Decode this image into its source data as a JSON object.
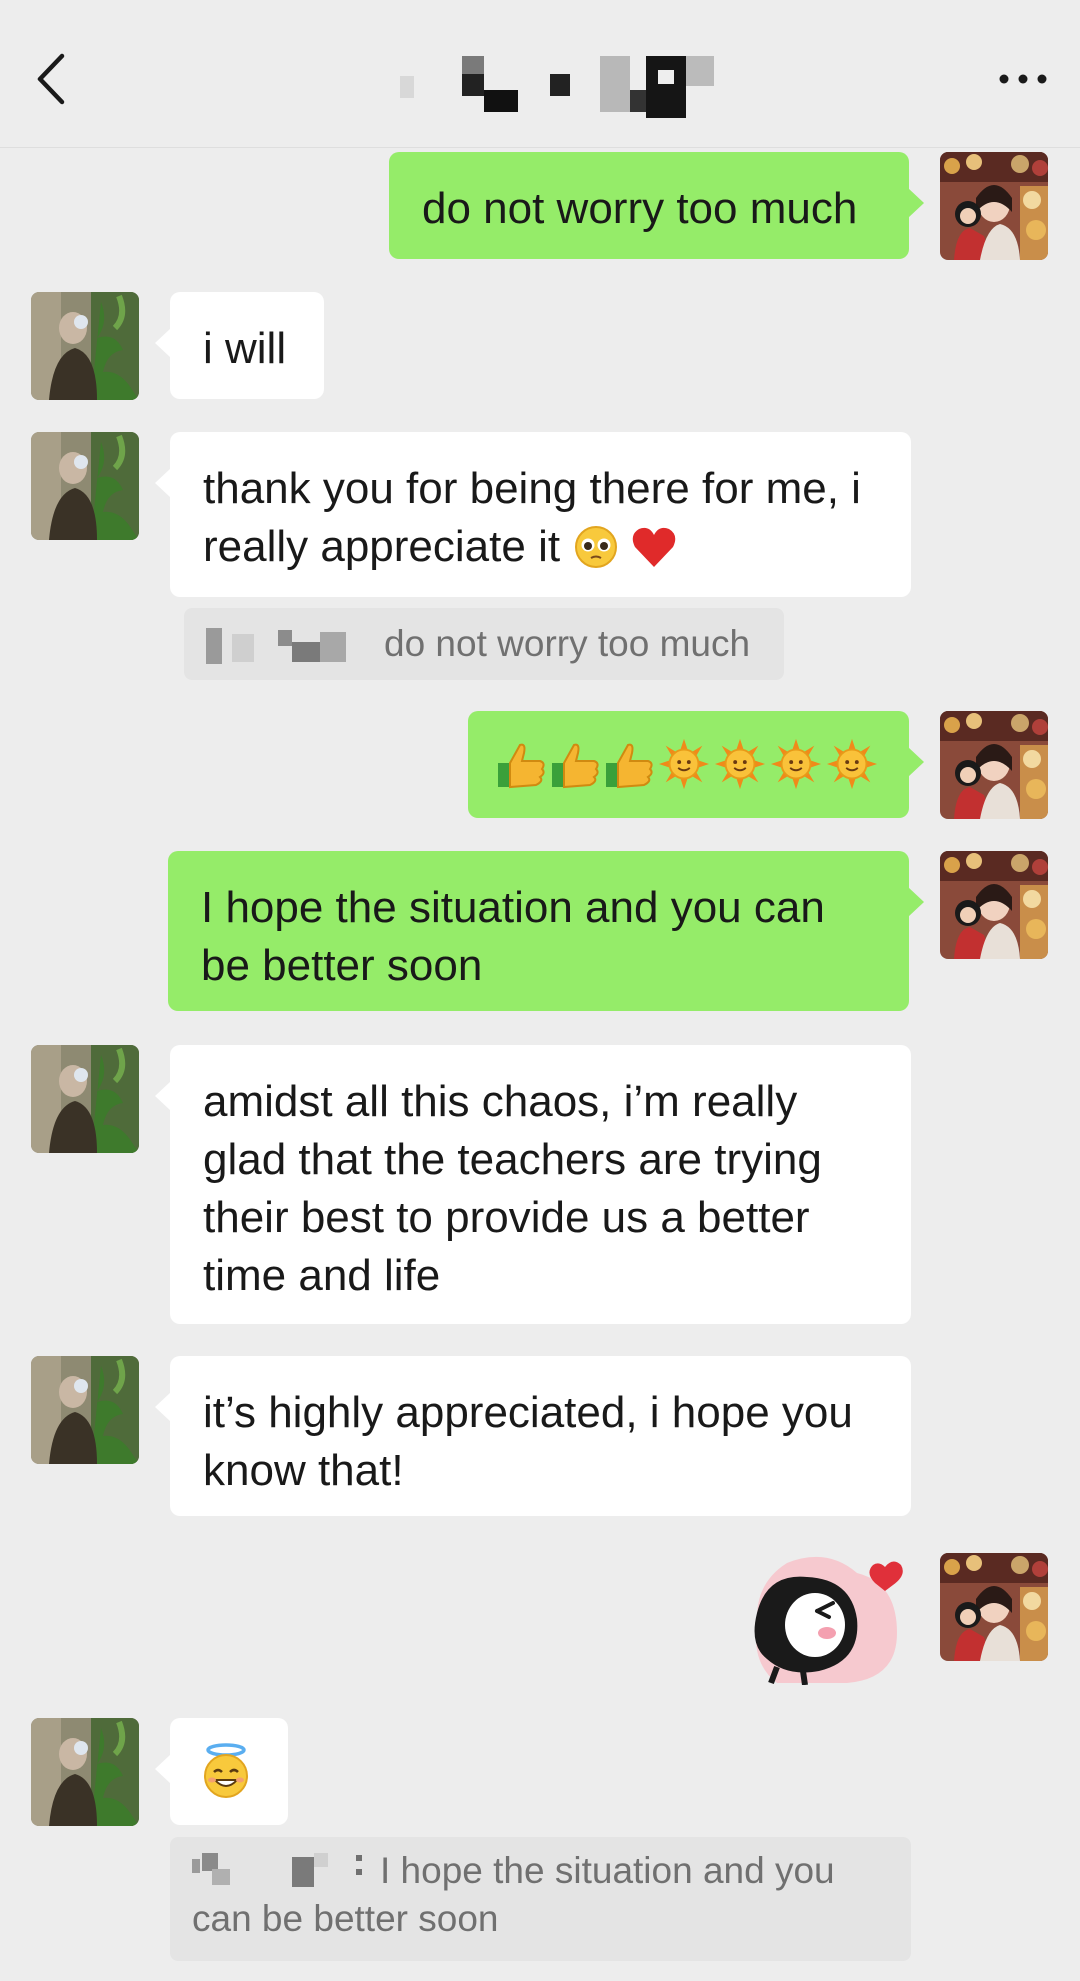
{
  "header": {
    "title": "",
    "back_icon": "chevron-left-icon",
    "more_icon": "ellipsis-icon"
  },
  "messages": [
    {
      "id": 1,
      "side": "right",
      "text": "do not worry too much"
    },
    {
      "id": 2,
      "side": "left",
      "text": "i will"
    },
    {
      "id": 3,
      "side": "left",
      "text": "thank you for being there for me, i really appreciate it",
      "emojis": [
        "pleading-face-emoji",
        "red-heart-emoji"
      ]
    },
    {
      "id": 4,
      "side": "left-quote",
      "text": "do not worry too much"
    },
    {
      "id": 5,
      "side": "right",
      "emojis": [
        "thumbs-up-emoji",
        "thumbs-up-emoji",
        "thumbs-up-emoji",
        "sun-emoji",
        "sun-emoji",
        "sun-emoji",
        "sun-emoji"
      ]
    },
    {
      "id": 6,
      "side": "right",
      "text": "I hope the situation and you can be better soon"
    },
    {
      "id": 7,
      "side": "left",
      "text": "amidst all this chaos, i’m really glad that the teachers are trying their best to provide us a better time and life"
    },
    {
      "id": 8,
      "side": "left",
      "text": "it’s highly appreciated, i hope you know that!"
    },
    {
      "id": 9,
      "side": "right",
      "sticker": "bird-kiss-heart-sticker"
    },
    {
      "id": 10,
      "side": "left",
      "emojis": [
        "smiling-face-with-halo-emoji"
      ]
    },
    {
      "id": 11,
      "side": "left-quote",
      "text": "I hope the situation and you can be better soon"
    }
  ],
  "colors": {
    "background": "#ededed",
    "sent_bubble": "#95ec69",
    "received_bubble": "#ffffff",
    "quote_bg": "#e4e4e4"
  }
}
